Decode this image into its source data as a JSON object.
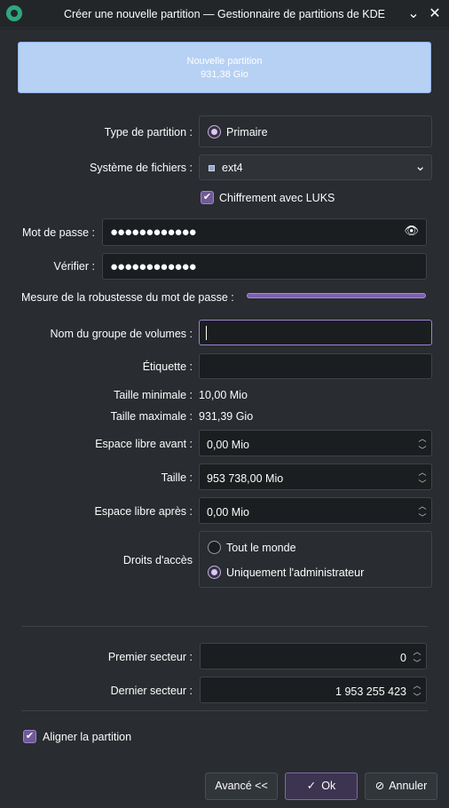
{
  "window": {
    "title": "Créer une nouvelle partition — Gestionnaire de partitions de KDE"
  },
  "preview": {
    "name": "Nouvelle partition",
    "size": "931,38 Gio"
  },
  "form": {
    "partition_type_label": "Type de partition :",
    "partition_type_value": "Primaire",
    "filesystem_label": "Système de fichiers :",
    "filesystem_value": "ext4",
    "luks_label": "Chiffrement avec LUKS",
    "password_label": "Mot de passe :",
    "password_value": "●●●●●●●●●●●●",
    "verify_label": "Vérifier :",
    "verify_value": "●●●●●●●●●●●●",
    "strength_label": "Mesure de la robustesse du mot de passe :",
    "strength_fraction": 1.0,
    "vg_label": "Nom du groupe de volumes :",
    "vg_value": "",
    "label_label": "Étiquette :",
    "label_value": "",
    "min_size_label": "Taille minimale :",
    "min_size_value": "10,00 Mio",
    "max_size_label": "Taille maximale :",
    "max_size_value": "931,39 Gio",
    "free_before_label": "Espace libre avant :",
    "free_before_value": "0,00 Mio",
    "size_label": "Taille :",
    "size_value": "953 738,00 Mio",
    "free_after_label": "Espace libre après :",
    "free_after_value": "0,00 Mio",
    "access_label": "Droits d'accès",
    "access_options": [
      "Tout le monde",
      "Uniquement l'administrateur"
    ],
    "access_selected": "Uniquement l'administrateur",
    "first_sector_label": "Premier secteur :",
    "first_sector_value": "0",
    "last_sector_label": "Dernier secteur :",
    "last_sector_value": "1 953 255 423",
    "align_label": "Aligner la partition"
  },
  "buttons": {
    "advanced": "Avancé <<",
    "ok": "Ok",
    "cancel": "Annuler"
  },
  "colors": {
    "accent": "#9f83d4",
    "preview_fill": "#b7d1f4",
    "background": "#292c30"
  }
}
